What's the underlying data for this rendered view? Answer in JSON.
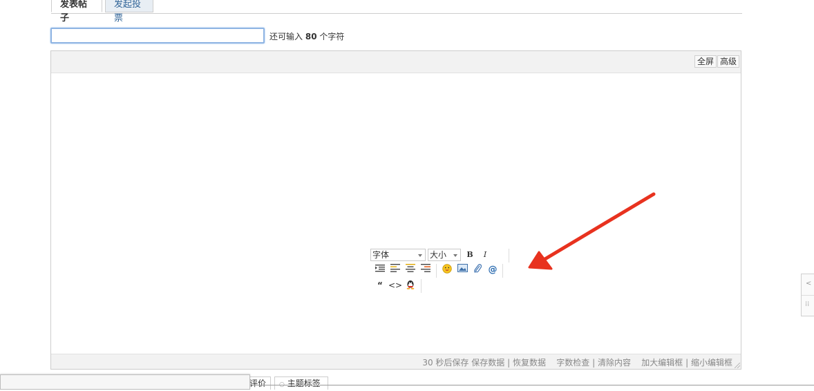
{
  "tabs": [
    {
      "label": "发表帖子",
      "active": true
    },
    {
      "label": "发起投票",
      "active": false
    }
  ],
  "subject": {
    "value": "",
    "hint_prefix": "还可输入",
    "hint_count": "80",
    "hint_suffix": "个字符"
  },
  "editor": {
    "fullscreen_label": "全屏",
    "advanced_label": "高级",
    "status": {
      "autosave": "30 秒后保存",
      "save": "保存数据",
      "restore": "恢复数据",
      "wordcount": "字数检查",
      "clear": "清除内容",
      "enlarge": "加大编辑框",
      "shrink": "缩小编辑框",
      "sep": "|"
    }
  },
  "toolbar": {
    "font_select": "字体",
    "size_select": "大小",
    "bold": "B",
    "italic": "I",
    "icons": [
      "indent-icon",
      "align-left-icon",
      "align-center-icon",
      "align-right-icon",
      "smiley-icon",
      "image-icon",
      "attachment-icon",
      "at-icon",
      "quote-icon",
      "code-icon",
      "qq-icon"
    ]
  },
  "lower_tabs": [
    {
      "label": "评价"
    },
    {
      "label": "主题标签"
    }
  ],
  "colors": {
    "arrow": "#e8321f",
    "tab_link": "#336699",
    "focus_border": "#8eb4e3"
  }
}
